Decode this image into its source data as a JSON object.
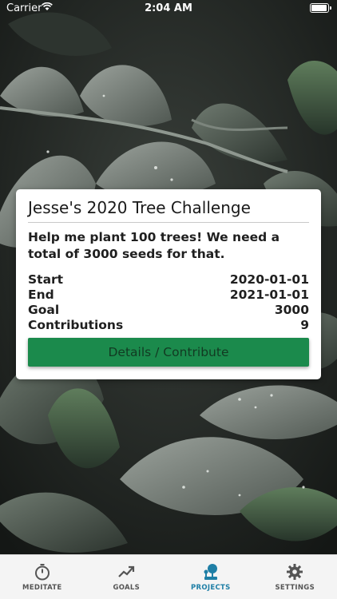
{
  "status_bar": {
    "carrier": "Carrier",
    "time": "2:04 AM"
  },
  "project_card": {
    "title": "Jesse's 2020 Tree Challenge",
    "description": "Help me plant 100 trees! We need a total of 3000 seeds for that.",
    "rows": [
      {
        "label": "Start",
        "value": "2020-01-01"
      },
      {
        "label": "End",
        "value": "2021-01-01"
      },
      {
        "label": "Goal",
        "value": "3000"
      },
      {
        "label": "Contributions",
        "value": "9"
      }
    ],
    "button_label": "Details / Contribute"
  },
  "tab_bar": {
    "tabs": [
      {
        "label": "MEDITATE",
        "icon": "stopwatch-icon"
      },
      {
        "label": "GOALS",
        "icon": "trend-up-icon"
      },
      {
        "label": "PROJECTS",
        "icon": "plant-icon",
        "active": true
      },
      {
        "label": "SETTINGS",
        "icon": "gear-icon"
      }
    ]
  },
  "colors": {
    "accent_green": "#1b8a4c",
    "active_tab": "#1f7fa6",
    "tab_bar_bg": "#f4f4f4"
  }
}
